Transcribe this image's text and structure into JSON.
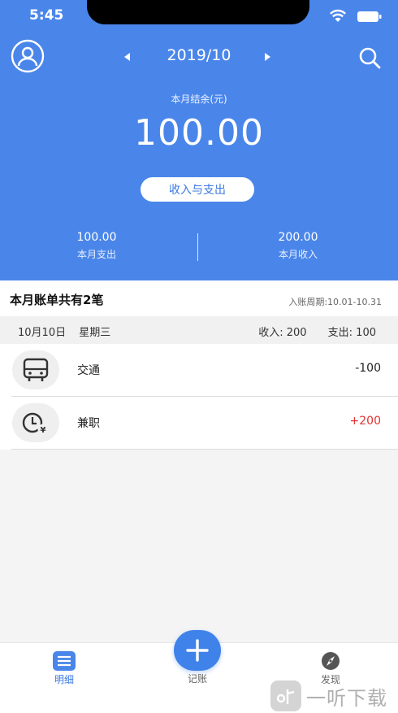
{
  "status_bar": {
    "time": "5:45"
  },
  "header": {
    "month": "2019/10",
    "balance_label": "本月结余(元)",
    "balance": "100.00",
    "toggle_button": "收入与支出",
    "expense": {
      "value": "100.00",
      "label": "本月支出"
    },
    "income": {
      "value": "200.00",
      "label": "本月收入"
    }
  },
  "summary": {
    "title": "本月账单共有2笔",
    "cycle": "入账周期:10.01-10.31"
  },
  "day_group": {
    "date": "10月10日",
    "weekday": "星期三",
    "income_summary": "收入: 200",
    "expense_summary": "支出: 100"
  },
  "transactions": [
    {
      "name": "交通",
      "amount": "-100",
      "icon": "bus-icon",
      "color": "#222222"
    },
    {
      "name": "兼职",
      "amount": "+200",
      "icon": "clock-yen-icon",
      "color": "#e0322f"
    }
  ],
  "tabbar": {
    "details": "明细",
    "add": "记账",
    "discover": "发现"
  },
  "colors": {
    "primary": "#4a86ea",
    "income": "#e0322f"
  },
  "watermark": {
    "text": "一听下载"
  }
}
